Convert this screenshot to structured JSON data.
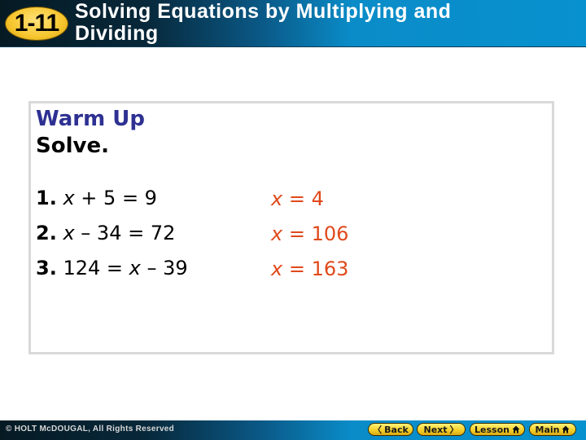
{
  "header": {
    "lesson_number": "1-11",
    "title_line1": "Solving Equations by Multiplying and",
    "title_line2": "Dividing"
  },
  "warm_up": {
    "heading": "Warm Up",
    "instruction": "Solve."
  },
  "problems": [
    {
      "number": "1.",
      "lhs": "x",
      "rest": " + 5 = 9",
      "answer_var": "x",
      "answer_rest": " = 4"
    },
    {
      "number": "2.",
      "lhs": "x",
      "rest": " – 34 = 72",
      "answer_var": "x",
      "answer_rest": " = 106"
    },
    {
      "number": "3.",
      "prefix": " 124 = ",
      "lhs": "x",
      "rest": " – 39",
      "answer_var": "x",
      "answer_rest": " = 163"
    }
  ],
  "footer": {
    "copyright": "© HOLT McDOUGAL, All Rights Reserved",
    "nav": {
      "back": "Back",
      "next": "Next",
      "lesson": "Lesson",
      "main": "Main"
    }
  },
  "colors": {
    "heading": "#2e3192",
    "answer": "#e0491b",
    "badge": "#f6c52d"
  }
}
